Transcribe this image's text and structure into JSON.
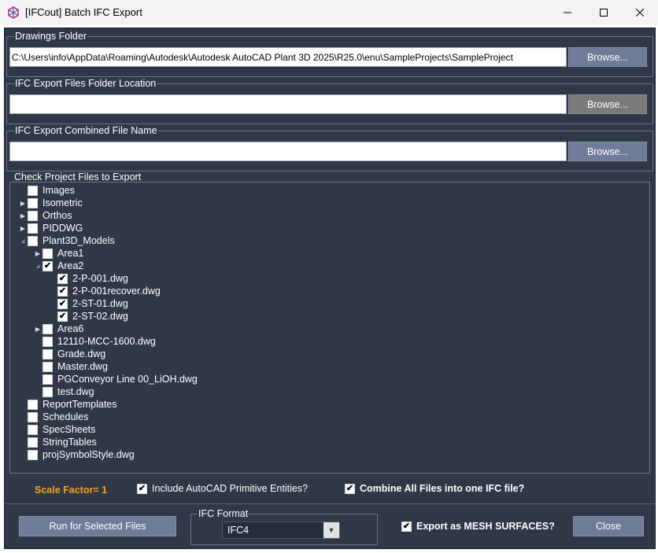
{
  "window": {
    "title": "[IFCout] Batch IFC Export"
  },
  "drawings": {
    "label": "Drawings Folder",
    "path": "C:\\Users\\info\\AppData\\Roaming\\Autodesk\\Autodesk AutoCAD Plant 3D 2025\\R25.0\\enu\\SampleProjects\\SampleProject",
    "browse": "Browse..."
  },
  "export_folder": {
    "label": "IFC Export Files Folder Location",
    "path": "",
    "browse": "Browse..."
  },
  "combined_name": {
    "label": "IFC Export Combined File Name",
    "value": "",
    "browse": "Browse..."
  },
  "tree": {
    "label": "Check Project Files to Export",
    "items": [
      {
        "label": "Images",
        "level": 0,
        "expander": "none",
        "checked": false
      },
      {
        "label": "Isometric",
        "level": 0,
        "expander": "collapsed",
        "checked": false
      },
      {
        "label": "Orthos",
        "level": 0,
        "expander": "collapsed",
        "checked": false
      },
      {
        "label": "PIDDWG",
        "level": 0,
        "expander": "collapsed",
        "checked": false
      },
      {
        "label": "Plant3D_Models",
        "level": 0,
        "expander": "expanded",
        "checked": false
      },
      {
        "label": "Area1",
        "level": 1,
        "expander": "collapsed",
        "checked": false
      },
      {
        "label": "Area2",
        "level": 1,
        "expander": "expanded",
        "checked": true
      },
      {
        "label": "2-P-001.dwg",
        "level": 2,
        "expander": "none",
        "checked": true
      },
      {
        "label": "2-P-001recover.dwg",
        "level": 2,
        "expander": "none",
        "checked": true
      },
      {
        "label": "2-ST-01.dwg",
        "level": 2,
        "expander": "none",
        "checked": true
      },
      {
        "label": "2-ST-02.dwg",
        "level": 2,
        "expander": "none",
        "checked": true
      },
      {
        "label": "Area6",
        "level": 1,
        "expander": "collapsed",
        "checked": false
      },
      {
        "label": "12110-MCC-1600.dwg",
        "level": 1,
        "expander": "none",
        "checked": false
      },
      {
        "label": "Grade.dwg",
        "level": 1,
        "expander": "none",
        "checked": false
      },
      {
        "label": "Master.dwg",
        "level": 1,
        "expander": "none",
        "checked": false
      },
      {
        "label": "PGConveyor Line 00_LiOH.dwg",
        "level": 1,
        "expander": "none",
        "checked": false
      },
      {
        "label": "test.dwg",
        "level": 1,
        "expander": "none",
        "checked": false
      },
      {
        "label": "ReportTemplates",
        "level": 0,
        "expander": "none",
        "checked": false
      },
      {
        "label": "Schedules",
        "level": 0,
        "expander": "none",
        "checked": false
      },
      {
        "label": "SpecSheets",
        "level": 0,
        "expander": "none",
        "checked": false
      },
      {
        "label": "StringTables",
        "level": 0,
        "expander": "none",
        "checked": false
      },
      {
        "label": "projSymbolStyle.dwg",
        "level": 0,
        "expander": "none",
        "checked": false
      }
    ]
  },
  "options": {
    "scale_factor": "Scale Factor= 1",
    "include_primitive": {
      "label": "Include AutoCAD Primitive Entities?",
      "checked": true
    },
    "combine_all": {
      "label": "Combine All Files into one IFC file?",
      "checked": true
    }
  },
  "footer": {
    "run_button": "Run for Selected Files",
    "ifc_format_label": "IFC Format",
    "ifc_format_value": "IFC4",
    "mesh": {
      "label": "Export as MESH SURFACES?",
      "checked": true
    },
    "close_button": "Close"
  },
  "icons": {
    "app": "ifcout-app-icon",
    "minimize": "minimize-icon",
    "maximize": "maximize-icon",
    "close": "close-icon"
  },
  "colors": {
    "background": "#303848",
    "button": "#6e7c98",
    "accent": "#f4a21c"
  }
}
